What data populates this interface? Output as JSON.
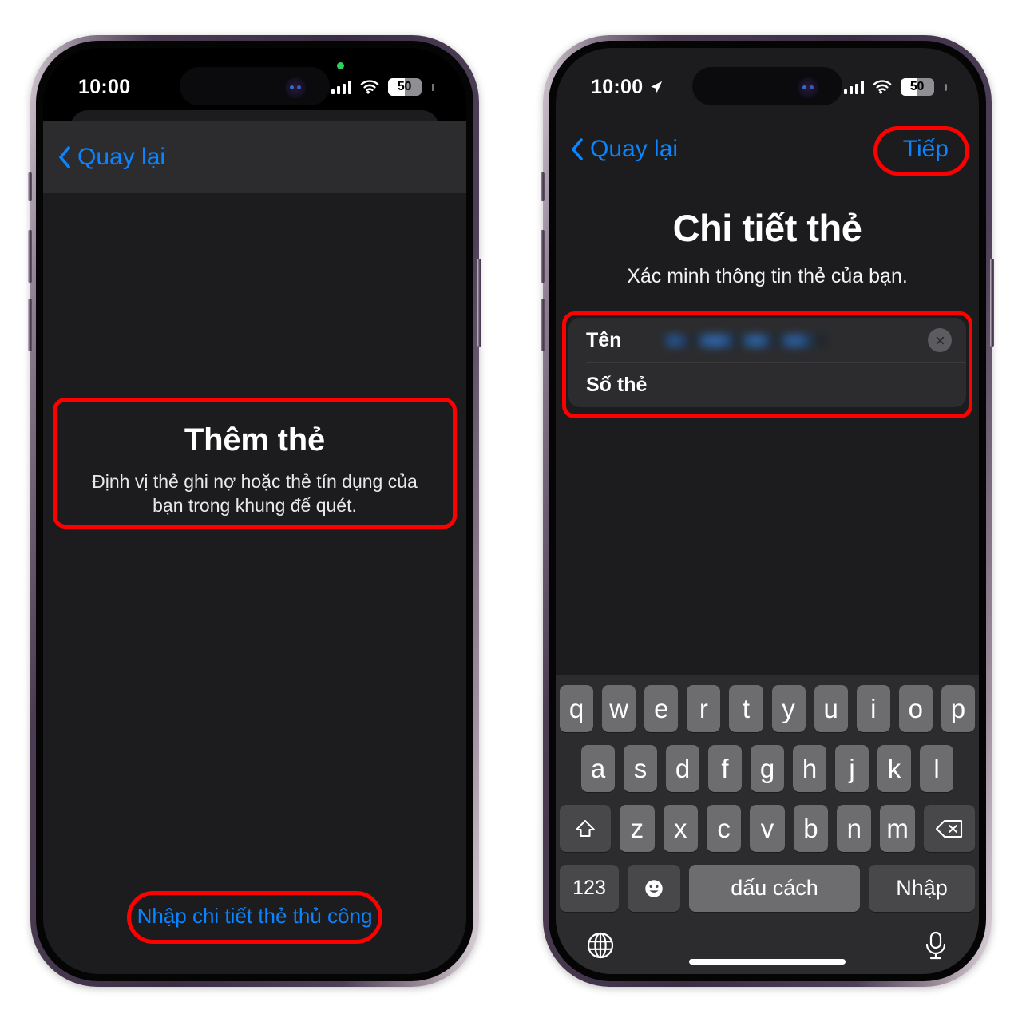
{
  "meta": {
    "accent_blue": "#0a84ff",
    "annotation_red": "#ff0000",
    "recording_dot_green": "#30d158"
  },
  "phone_left": {
    "status_bar": {
      "time": "10:00",
      "battery_level": "50",
      "signal_icon": "cellular-bars-icon",
      "wifi_icon": "wifi-icon",
      "recording_indicator": "green-recording-dot"
    },
    "nav": {
      "back_label": "Quay lại",
      "back_icon": "chevron-left-icon"
    },
    "hint": {
      "title": "Thêm thẻ",
      "subtitle": "Định vị thẻ ghi nợ hoặc thẻ tín dụng của bạn trong khung để quét."
    },
    "manual_entry_label": "Nhập chi tiết thẻ thủ công"
  },
  "phone_right": {
    "status_bar": {
      "time": "10:00",
      "battery_level": "50",
      "location_icon": "location-arrow-icon",
      "signal_icon": "cellular-bars-icon",
      "wifi_icon": "wifi-icon"
    },
    "nav": {
      "back_label": "Quay lại",
      "back_icon": "chevron-left-icon",
      "next_label": "Tiếp"
    },
    "page": {
      "title": "Chi tiết thẻ",
      "subtitle": "Xác minh thông tin thẻ của bạn."
    },
    "form": {
      "rows": [
        {
          "label": "Tên",
          "value": "",
          "value_state": "redacted",
          "clear_icon": "clear-circle-x-icon"
        },
        {
          "label": "Số thẻ",
          "value": ""
        }
      ]
    },
    "keyboard": {
      "row1": [
        "q",
        "w",
        "e",
        "r",
        "t",
        "y",
        "u",
        "i",
        "o",
        "p"
      ],
      "row2": [
        "a",
        "s",
        "d",
        "f",
        "g",
        "h",
        "j",
        "k",
        "l"
      ],
      "row3": [
        "z",
        "x",
        "c",
        "v",
        "b",
        "n",
        "m"
      ],
      "shift_icon": "shift-arrow-up-icon",
      "backspace_icon": "backspace-delete-icon",
      "numbers_label": "123",
      "emoji_icon": "emoji-smiley-icon",
      "space_label": "dấu cách",
      "enter_label": "Nhập",
      "globe_icon": "globe-language-icon",
      "mic_icon": "microphone-dictation-icon"
    }
  }
}
